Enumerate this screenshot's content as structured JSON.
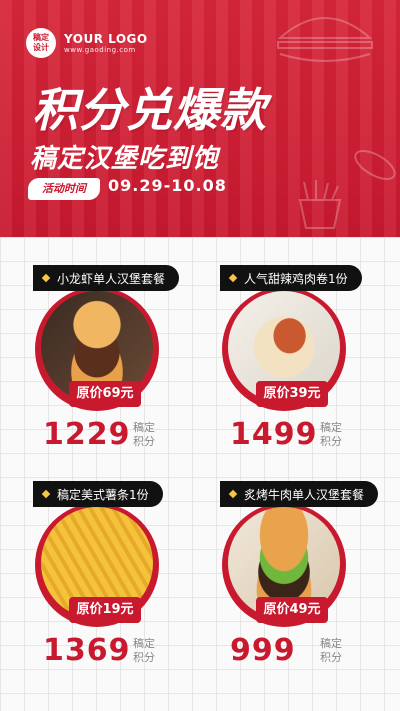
{
  "brand": {
    "badge_line1": "稿定",
    "badge_line2": "设计",
    "name": "YOUR LOGO",
    "site": "www.gaoding.com"
  },
  "hero": {
    "title": "积分兑爆款",
    "subtitle": "稿定汉堡吃到饱",
    "time_label": "活动时间",
    "date_range": "09.29-10.08"
  },
  "products": [
    {
      "name": "小龙虾单人汉堡套餐",
      "price": "原价69元",
      "points": "1229",
      "unit_line1": "稿定",
      "unit_line2": "积分"
    },
    {
      "name": "人气甜辣鸡肉卷1份",
      "price": "原价39元",
      "points": "1499",
      "unit_line1": "稿定",
      "unit_line2": "积分"
    },
    {
      "name": "稿定美式薯条1份",
      "price": "原价19元",
      "points": "1369",
      "unit_line1": "稿定",
      "unit_line2": "积分"
    },
    {
      "name": "炙烤牛肉单人汉堡套餐",
      "price": "原价49元",
      "points": "999",
      "unit_line1": "稿定",
      "unit_line2": "积分"
    }
  ],
  "colors": {
    "primary": "#c8192f",
    "pill": "#111111",
    "accent": "#f6c744"
  }
}
